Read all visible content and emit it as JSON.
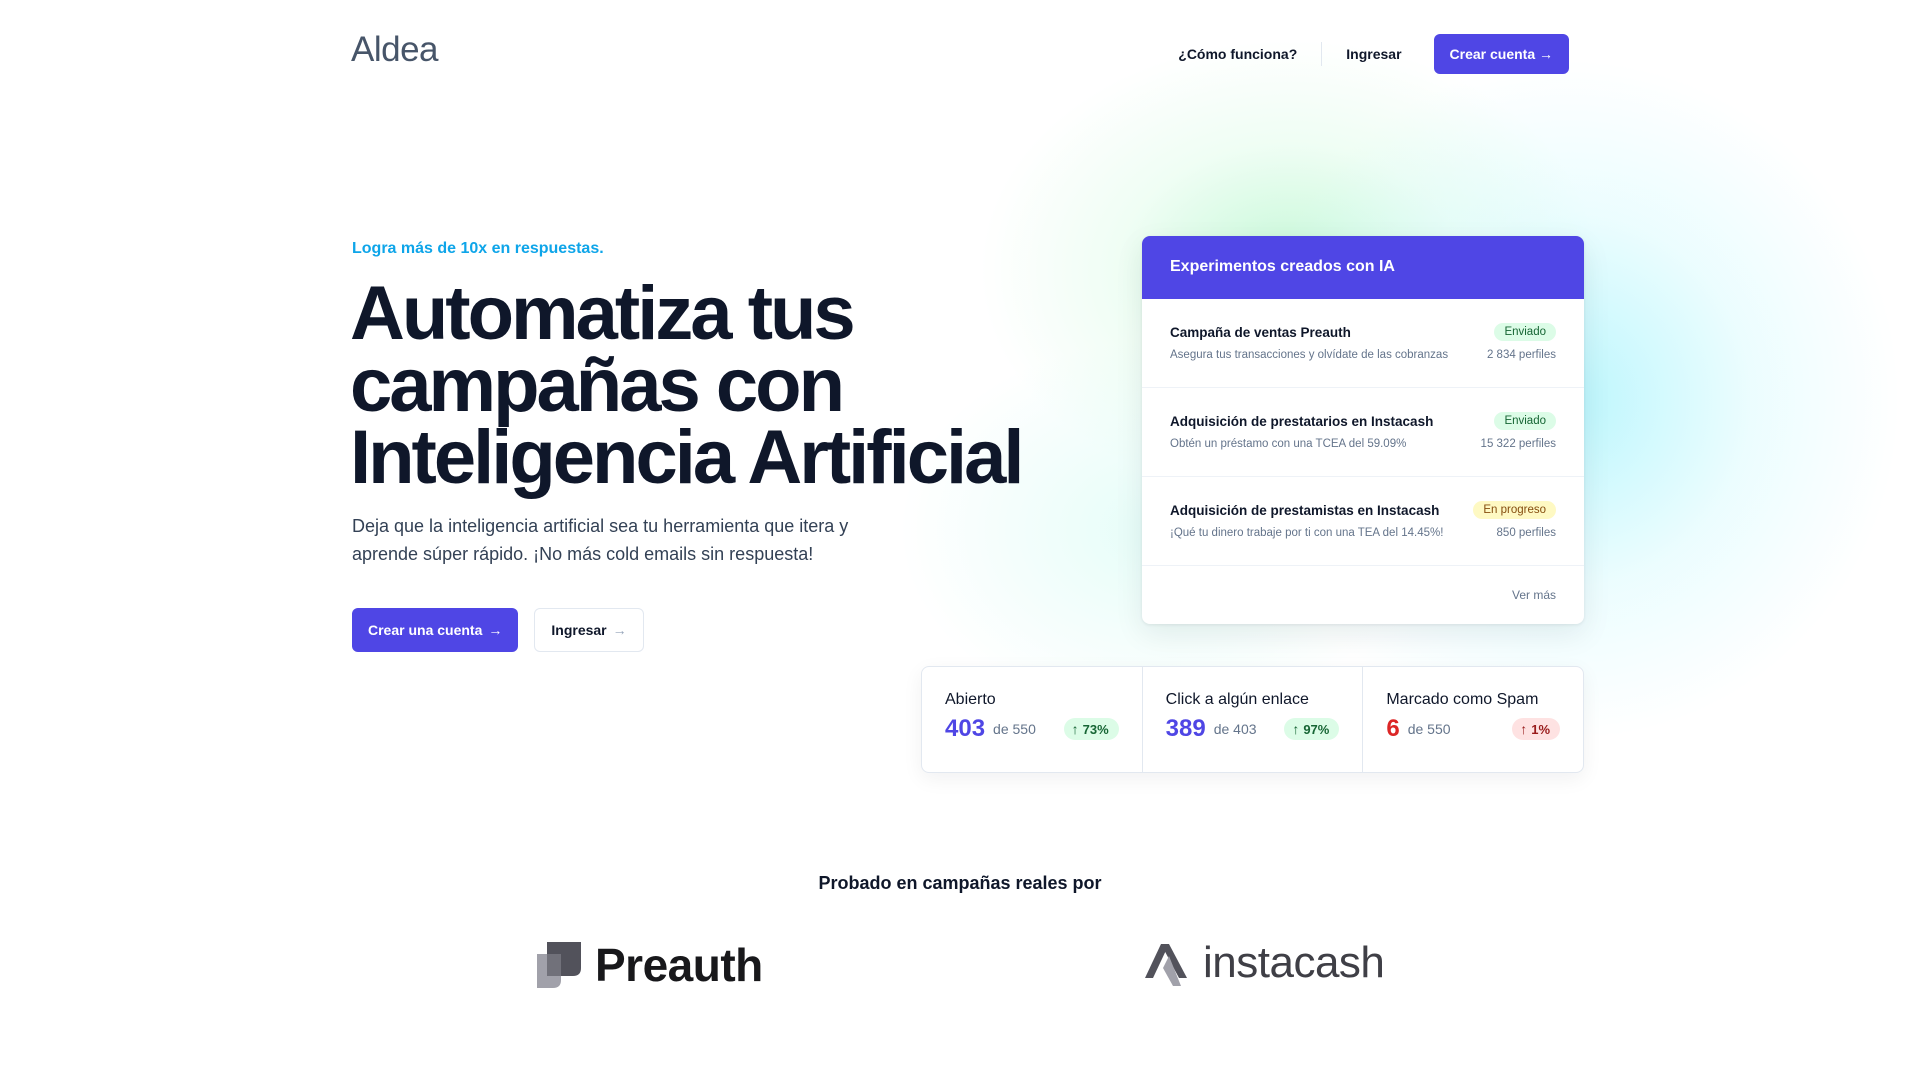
{
  "header": {
    "logo": "Aldea",
    "nav": {
      "how_it_works": "¿Cómo funciona?",
      "login": "Ingresar",
      "signup": "Crear cuenta →"
    }
  },
  "hero": {
    "tagline": "Logra más de 10x en respuestas.",
    "headline_1": "Automatiza tus",
    "headline_2": "campañas con",
    "headline_3": "Inteligencia Artificial",
    "subline_1": "Deja que la inteligencia artificial sea tu herramienta que itera y",
    "subline_2": "aprende súper rápido. ¡No más cold emails sin respuesta!",
    "cta_primary": "Crear una cuenta",
    "cta_secondary": "Ingresar",
    "arrow": "→"
  },
  "experiments": {
    "title": "Experimentos creados con IA",
    "items": [
      {
        "name": "Campaña de ventas Preauth",
        "status": "Enviado",
        "description": "Asegura tus transacciones y olvídate de las cobranzas",
        "profiles": "2 834 perfiles"
      },
      {
        "name": "Adquisición de prestatarios en Instacash",
        "status": "Enviado",
        "description": "Obtén un préstamo con una TCEA del 59.09%",
        "profiles": "15 322 perfiles"
      },
      {
        "name": "Adquisición de prestamistas en Instacash",
        "status": "En progreso",
        "description": "¡Qué tu dinero trabaje por ti con una TEA del 14.45%!",
        "profiles": "850 perfiles"
      }
    ],
    "more": "Ver más"
  },
  "stats": [
    {
      "label": "Abierto",
      "value": "403",
      "total": "de 550",
      "change": "73%"
    },
    {
      "label": "Click a algún enlace",
      "value": "389",
      "total": "de 403",
      "change": "97%"
    },
    {
      "label": "Marcado como Spam",
      "value": "6",
      "total": "de 550",
      "change": "1%"
    }
  ],
  "proof": {
    "title": "Probado en campañas reales por",
    "logos": [
      "Preauth",
      "instacash"
    ]
  },
  "icons": {
    "up": "arrow-up-icon",
    "preauth_mark": "preauth-logo-icon",
    "instacash_mark": "instacash-logo-icon"
  },
  "colors": {
    "primary": "#4f46e5",
    "tagline": "#0ea5e9",
    "success_bg": "#dcfce7",
    "progress_bg": "#fef9c3",
    "danger": "#dc2626"
  }
}
